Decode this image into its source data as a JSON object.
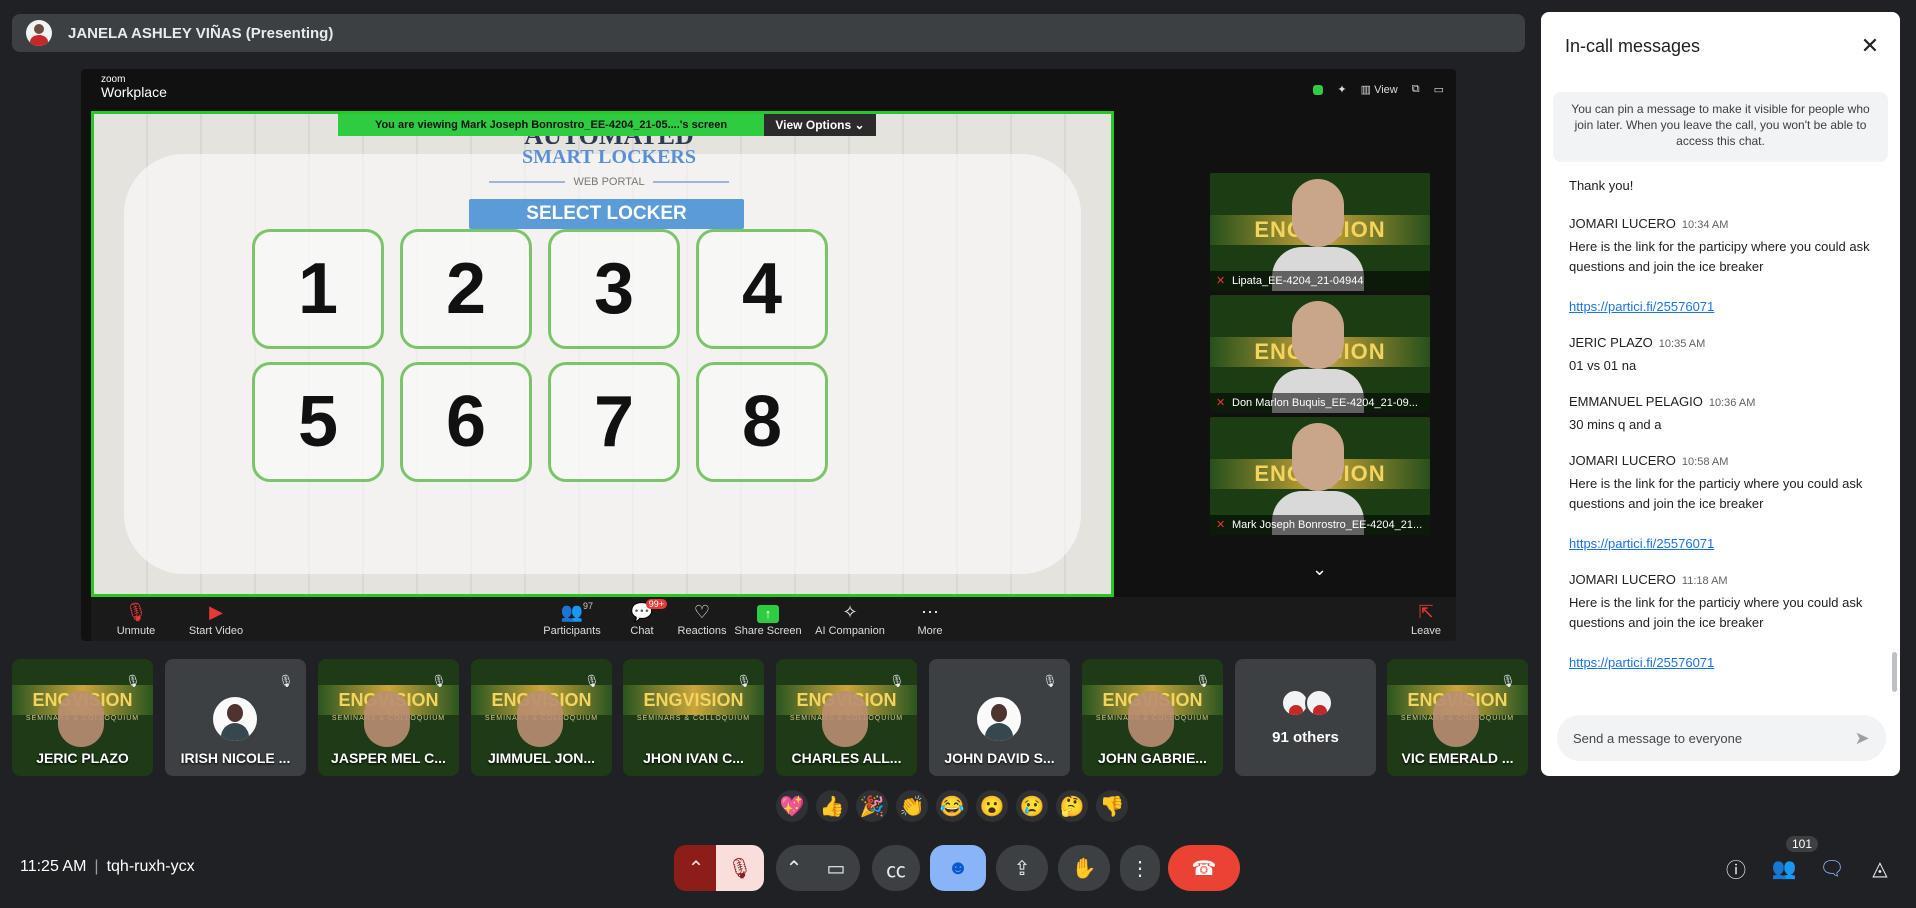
{
  "presenter": {
    "name": "JANELA ASHLEY VIÑAS (Presenting)"
  },
  "zoom": {
    "logo_top": "zoom",
    "logo_bottom": "Workplace",
    "view_label": "View",
    "viewing_banner": "You are viewing  Mark Joseph Bonrostro_EE-4204_21-05....'s screen",
    "view_options": "View Options",
    "gallery": [
      {
        "name": "Lipata_EE-4204_21-04944"
      },
      {
        "name": "Don Marlon Buquis_EE-4204_21-09..."
      },
      {
        "name": "Mark Joseph Bonrostro_EE-4204_21..."
      }
    ],
    "toolbar": {
      "unmute": "Unmute",
      "start_video": "Start Video",
      "participants": "Participants",
      "participants_count": "97",
      "chat": "Chat",
      "chat_badge": "99+",
      "reactions": "Reactions",
      "share_screen": "Share Screen",
      "ai_companion": "AI Companion",
      "more": "More",
      "leave": "Leave"
    }
  },
  "app": {
    "title_line1": "AUTOMATED",
    "title_line2": "SMART LOCKERS",
    "web_portal": "WEB PORTAL",
    "select_locker": "SELECT LOCKER",
    "lockers": [
      "1",
      "2",
      "3",
      "4",
      "5",
      "6",
      "7",
      "8"
    ]
  },
  "tile_banner": "ENGVISION",
  "tile_banner_sub": "SEMINARS & COLLOQUIUM",
  "participants": [
    {
      "name": "JERIC PLAZO"
    },
    {
      "name": "IRISH NICOLE ..."
    },
    {
      "name": "JASPER MEL C..."
    },
    {
      "name": "JIMMUEL JON..."
    },
    {
      "name": "JHON IVAN C..."
    },
    {
      "name": "CHARLES ALL..."
    },
    {
      "name": "JOHN DAVID S..."
    },
    {
      "name": "JOHN GABRIE..."
    },
    {
      "name": "91 others"
    },
    {
      "name": "VIC EMERALD ..."
    }
  ],
  "reactions": [
    "💖",
    "👍",
    "🎉",
    "👏",
    "😂",
    "😮",
    "😢",
    "🤔",
    "👎"
  ],
  "meeting": {
    "time": "11:25 AM",
    "code": "tqh-ruxh-ycx",
    "people_count": "101"
  },
  "chat": {
    "title": "In-call messages",
    "pin_note": "You can pin a message to make it visible for people who join later. When you leave the call, you won't be able to access this chat.",
    "messages": [
      {
        "sender": "",
        "time": "",
        "text": "Thank you!"
      },
      {
        "sender": "JOMARI LUCERO",
        "time": "10:34 AM",
        "text": "Here is the link for the participy where you could ask questions and join the ice breaker",
        "link": "https://partici.fi/25576071"
      },
      {
        "sender": "JERIC PLAZO",
        "time": "10:35 AM",
        "text": "01 vs 01 na"
      },
      {
        "sender": "EMMANUEL PELAGIO",
        "time": "10:36 AM",
        "text": "30 mins q and a"
      },
      {
        "sender": "JOMARI LUCERO",
        "time": "10:58 AM",
        "text": "Here is the link for the particiy where you could ask questions and join the ice breaker",
        "link": "https://partici.fi/25576071"
      },
      {
        "sender": "JOMARI LUCERO",
        "time": "11:18 AM",
        "text": "Here is the link for the particiy where you could ask questions and join the ice breaker",
        "link": "https://partici.fi/25576071"
      }
    ],
    "input_placeholder": "Send a message to everyone"
  },
  "colors": {
    "accent": "#8ab4f8",
    "leave": "#ea4335",
    "zoom_green": "#2ecc40",
    "background": "#202124"
  }
}
